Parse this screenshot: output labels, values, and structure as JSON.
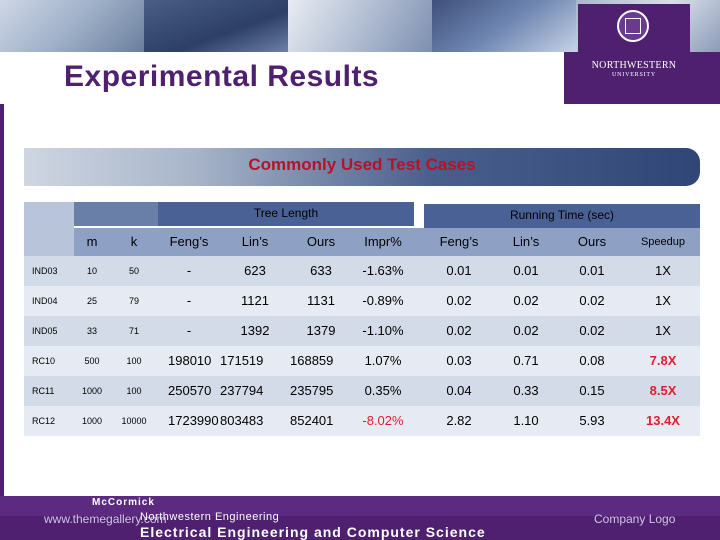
{
  "slide": {
    "title": "Experimental Results",
    "subtitle": "Commonly Used Test Cases"
  },
  "logo": {
    "name": "NORTHWESTERN",
    "sub": "UNIVERSITY"
  },
  "table": {
    "group_tree": "Tree Length",
    "group_time": "Running Time (sec)",
    "columns": [
      "m",
      "k",
      "Feng’s",
      "Lin’s",
      "Ours",
      "Impr%",
      "Feng’s",
      "Lin’s",
      "Ours",
      "Speedup"
    ],
    "rows": [
      {
        "label": "IND03",
        "cells": [
          "10",
          "50",
          "-",
          "623",
          "633",
          "-1.63%",
          "0.01",
          "0.01",
          "0.01",
          "1X"
        ]
      },
      {
        "label": "IND04",
        "cells": [
          "25",
          "79",
          "-",
          "1121",
          "1131",
          "-0.89%",
          "0.02",
          "0.02",
          "0.02",
          "1X"
        ]
      },
      {
        "label": "IND05",
        "cells": [
          "33",
          "71",
          "-",
          "1392",
          "1379",
          "-1.10%",
          "0.02",
          "0.02",
          "0.02",
          "1X"
        ]
      },
      {
        "label": "RC10",
        "cells": [
          "500",
          "100",
          "198010",
          "171519",
          "168859",
          "1.07%",
          "0.03",
          "0.71",
          "0.08",
          "7.8X"
        ]
      },
      {
        "label": "RC11",
        "cells": [
          "1000",
          "100",
          "250570",
          "237794",
          "235795",
          "0.35%",
          "0.04",
          "0.33",
          "0.15",
          "8.5X"
        ]
      },
      {
        "label": "RC12",
        "cells": [
          "1000",
          "10000",
          "1723990",
          "803483",
          "852401",
          "-8.02%",
          "2.82",
          "1.10",
          "5.93",
          "13.4X"
        ]
      }
    ]
  },
  "footer": {
    "mccormick": "McCormick",
    "northwestern_eng": "Northwestern Engineering",
    "eecs": "Electrical Engineering and Computer Science",
    "url": "www.themegallery.com",
    "company_logo": "Company Logo"
  },
  "colors": {
    "brand_purple": "#4f2070",
    "accent_red": "#e11d2e",
    "header_blue": "#4a6196"
  }
}
